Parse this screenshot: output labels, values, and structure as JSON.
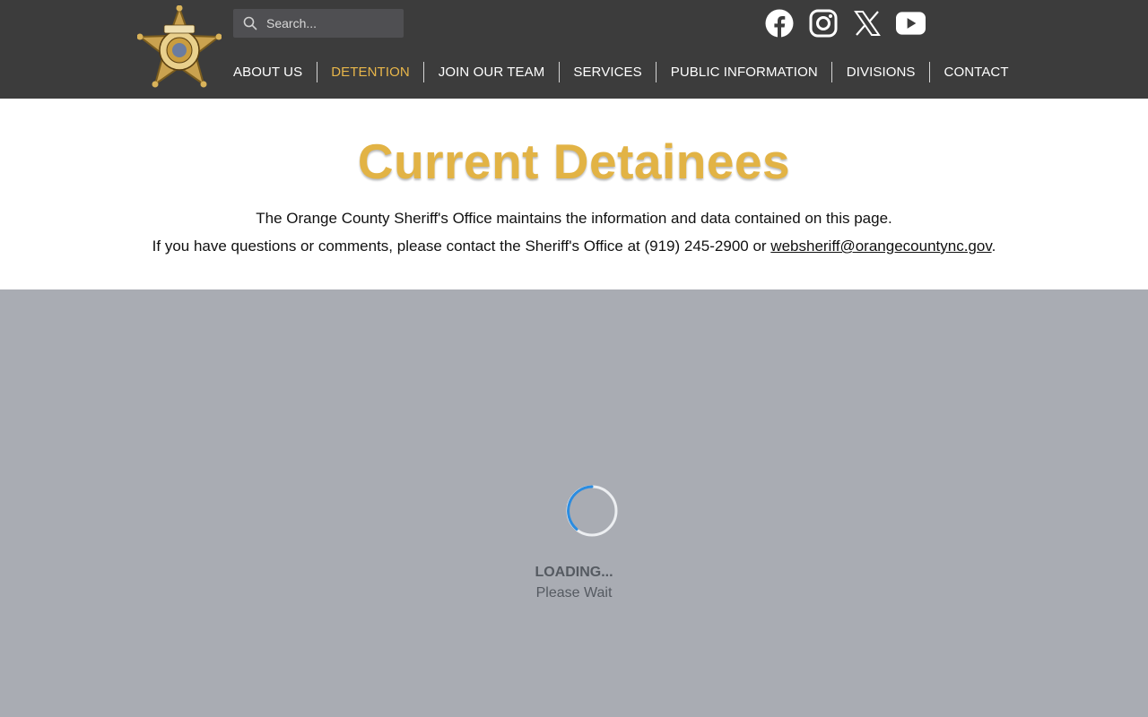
{
  "header": {
    "badge_icon": "sheriff-star-badge-icon",
    "search": {
      "placeholder": "Search...",
      "value": ""
    },
    "social": [
      {
        "name": "facebook-icon"
      },
      {
        "name": "instagram-icon"
      },
      {
        "name": "x-icon"
      },
      {
        "name": "youtube-icon"
      }
    ],
    "nav": {
      "about": "ABOUT US",
      "detention": "DETENTION",
      "join": "JOIN OUR TEAM",
      "services": "SERVICES",
      "public_info": "PUBLIC INFORMATION",
      "divisions": "DIVISIONS",
      "contact": "CONTACT"
    },
    "active_nav": "DETENTION"
  },
  "intro": {
    "title": "Current Detainees",
    "line1": "The Orange County Sheriff's Office maintains the information and data contained on this page.",
    "line2_prefix": "If you have questions or comments, please contact the Sheriff's Office at (919) 245-2900 or ",
    "email": "websheriff@orangecountync.gov",
    "line2_suffix": "."
  },
  "loading": {
    "title": "LOADING...",
    "subtitle": "Please Wait"
  },
  "colors": {
    "header_bg": "#3c3c3c",
    "accent": "#e2b345",
    "loading_bg": "#a9acb3",
    "spinner": "#2b8ce0"
  }
}
